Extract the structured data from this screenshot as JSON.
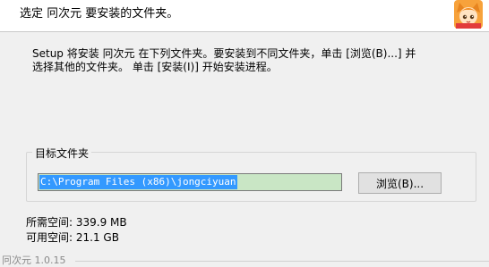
{
  "header": {
    "title": "选定 冋次元 要安装的文件夹。",
    "logo_icon": "anime-character-logo-icon"
  },
  "instructions": "Setup 将安装 冋次元 在下列文件夹。要安装到不同文件夹，单击 [浏览(B)...] 并\n选择其他的文件夹。 单击 [安装(I)] 开始安装进程。",
  "destination": {
    "group_label": "目标文件夹",
    "path_value": "C:\\Program Files (x86)\\jongciyuan",
    "browse_label": "浏览(B)..."
  },
  "space": {
    "required_label": "所需空间:",
    "required_value": "339.9 MB",
    "available_label": "可用空间:",
    "available_value": "21.1 GB"
  },
  "footer": {
    "brand": "冋次元 1.0.15"
  },
  "colors": {
    "selection": "#3399ff",
    "input_background": "#c9e6c5",
    "window_background": "#f0f0f0"
  }
}
